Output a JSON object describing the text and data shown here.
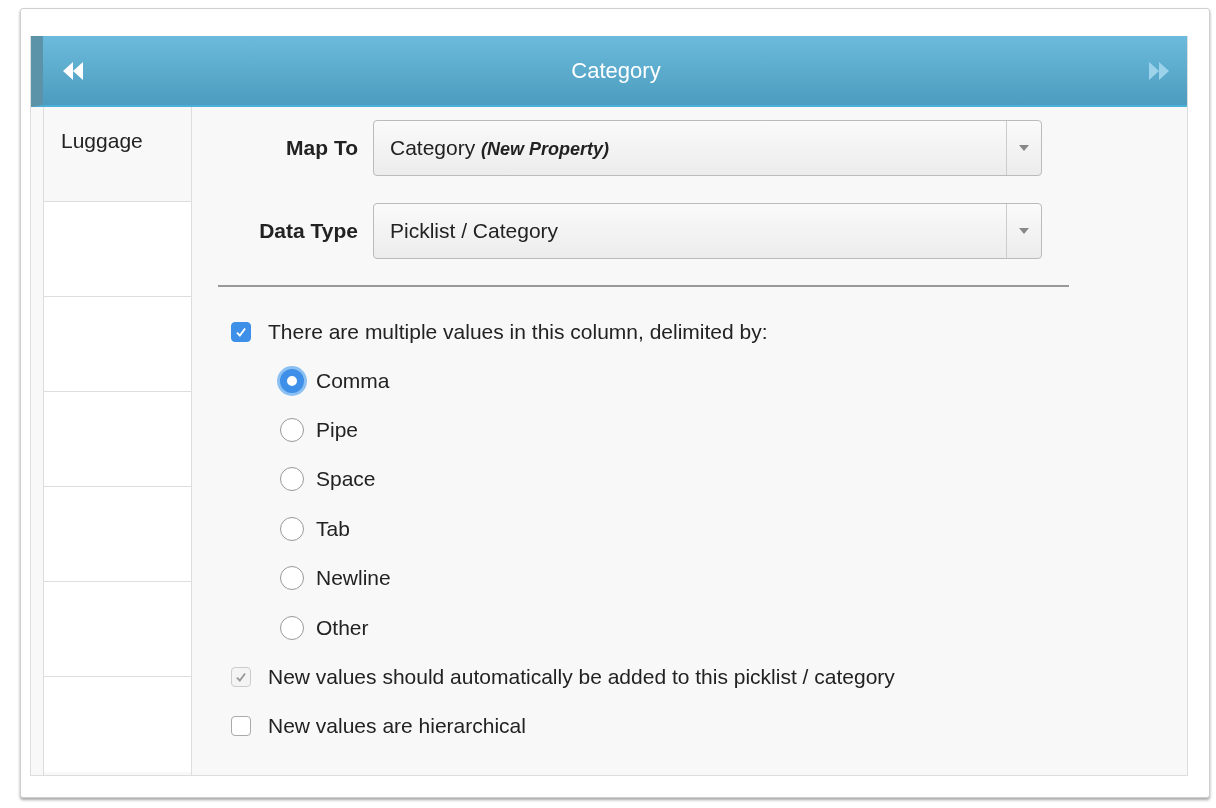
{
  "header": {
    "title": "Category",
    "prev": {
      "disabled": false
    },
    "next": {
      "disabled": true
    }
  },
  "column": {
    "rows": [
      {
        "text": "Luggage"
      }
    ]
  },
  "fields": [
    {
      "label": "Map To",
      "value": "Category *(New Property)*"
    },
    {
      "label": "Data Type",
      "value": "Picklist / Category"
    }
  ],
  "multi_values": {
    "label": "There are multiple values in this column, delimited by:",
    "checked": true,
    "disabled": false
  },
  "delimiters": [
    {
      "label": "Comma",
      "selected": true
    },
    {
      "label": "Pipe",
      "selected": false
    },
    {
      "label": "Space",
      "selected": false
    },
    {
      "label": "Tab",
      "selected": false
    },
    {
      "label": "Newline",
      "selected": false
    },
    {
      "label": "Other",
      "selected": false
    }
  ],
  "options": [
    {
      "label": "New values should automatically be added to this picklist / category",
      "checked": true,
      "disabled": true
    },
    {
      "label": "New values are hierarchical",
      "checked": false,
      "disabled": false
    }
  ]
}
